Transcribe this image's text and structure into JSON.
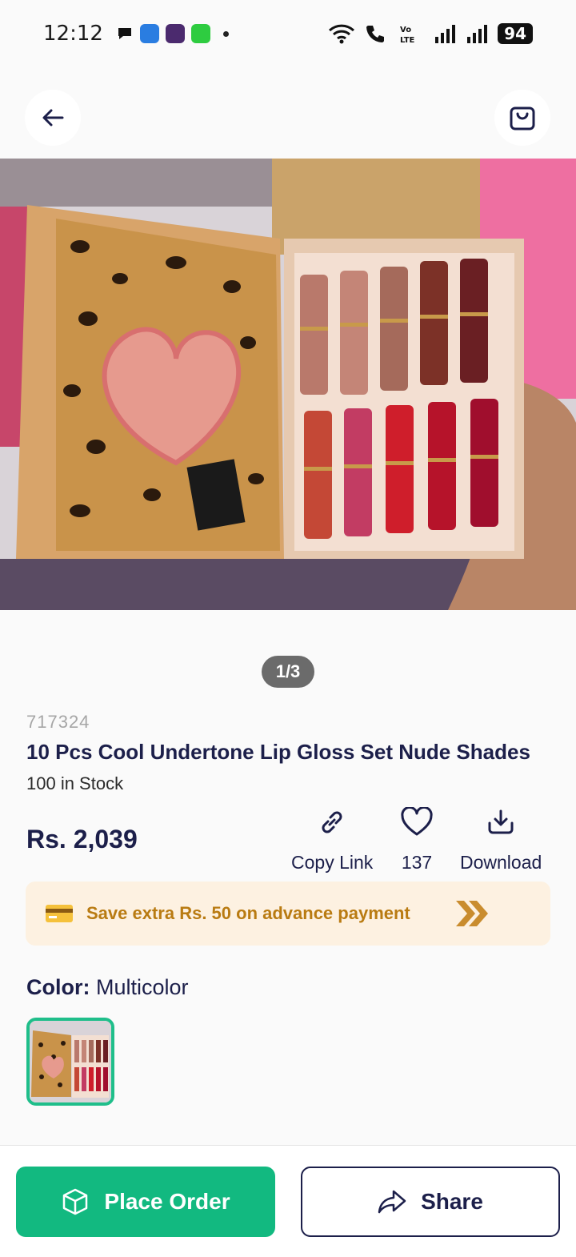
{
  "status_bar": {
    "time": "12:12",
    "battery": "94",
    "notification_icons": [
      "chat-bubble-icon",
      "app-icon-blue",
      "app-icon-purple-16",
      "app-icon-green"
    ],
    "system_icons": [
      "wifi-icon",
      "call-icon",
      "volte-icon",
      "signal-icon",
      "signal-icon"
    ]
  },
  "nav": {
    "back_icon": "arrow-left-icon",
    "cart_icon": "shopping-bag-icon"
  },
  "gallery": {
    "pager": "1/3"
  },
  "product": {
    "sku": "717324",
    "title": "10 Pcs Cool Undertone Lip Gloss Set Nude Shades",
    "stock": "100 in Stock",
    "price": "Rs. 2,039"
  },
  "actions": {
    "copy_link": "Copy Link",
    "likes": "137",
    "download": "Download"
  },
  "promo": {
    "text": "Save extra Rs. 50 on advance payment"
  },
  "color": {
    "label": "Color:",
    "value": "Multicolor"
  },
  "footer": {
    "place_order": "Place Order",
    "share": "Share"
  },
  "colors": {
    "accent": "#12b980",
    "navy": "#1c1f4a",
    "promo_bg": "#fdf1e1",
    "promo_text": "#b97b12"
  }
}
